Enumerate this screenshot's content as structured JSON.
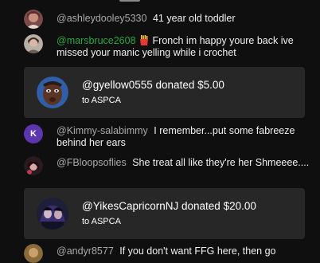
{
  "messages": [
    {
      "author": "@ashleydooley5330",
      "text": "41 year old toddler",
      "avatar_icon": "user-avatar-photo"
    },
    {
      "author": "@marsbruce2608",
      "author_color": "#2ba640",
      "badge_icon": "french-fries-emoji-icon",
      "text": "Fronch im happy youre back ive missed your manic yelling while i crochet",
      "avatar_icon": "user-avatar-photo"
    },
    {
      "author": "@Kimmy-salabimmy",
      "text": "I remember...put some fabreeze behind her ears",
      "avatar_letter": "K",
      "avatar_color": "#5e35b1"
    },
    {
      "author": "@FBloopsoflies",
      "text": "She treat all like they're her Shmeeee....",
      "avatar_icon": "user-avatar-photo"
    },
    {
      "author": "@andyr8577",
      "text": "If you don't want FFG here, then go",
      "avatar_icon": "user-avatar-photo"
    }
  ],
  "donations": [
    {
      "donor": "@gyellow0555",
      "donated_label": "donated",
      "amount": "$5.00",
      "to_label": "to ASPCA",
      "avatar_icon": "donor-avatar-photo"
    },
    {
      "donor": "@YikesCapricornNJ",
      "donated_label": "donated",
      "amount": "$20.00",
      "to_label": "to ASPCA",
      "avatar_icon": "donor-avatar-photo"
    }
  ],
  "colors": {
    "background": "#0f0f0f",
    "card": "#272727",
    "author": "#aaaaaa",
    "member_author": "#2ba640",
    "text": "#f1f1f1"
  }
}
